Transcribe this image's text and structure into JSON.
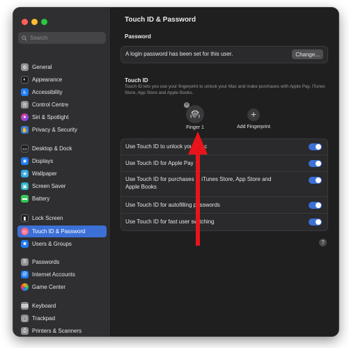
{
  "window": {
    "traffic_colors": [
      "#ff5f57",
      "#febc2e",
      "#28c840"
    ]
  },
  "search": {
    "placeholder": "Search"
  },
  "sidebar": {
    "items": [
      {
        "label": "General",
        "icon": "gear-icon",
        "color": "#8e8e93"
      },
      {
        "label": "Appearance",
        "icon": "appearance-icon",
        "color": "#1c1c1e"
      },
      {
        "label": "Accessibility",
        "icon": "accessibility-icon",
        "color": "#1e7cf2"
      },
      {
        "label": "Control Centre",
        "icon": "control-centre-icon",
        "color": "#8e8e93"
      },
      {
        "label": "Siri & Spotlight",
        "icon": "siri-icon",
        "color": "#c445d8"
      },
      {
        "label": "Privacy & Security",
        "icon": "hand-icon",
        "color": "#3a7bd5"
      },
      {
        "label": "Desktop & Dock",
        "icon": "dock-icon",
        "color": "#1c1c1e"
      },
      {
        "label": "Displays",
        "icon": "display-icon",
        "color": "#1e7cf2"
      },
      {
        "label": "Wallpaper",
        "icon": "wallpaper-icon",
        "color": "#34a8e0"
      },
      {
        "label": "Screen Saver",
        "icon": "screen-saver-icon",
        "color": "#30b0c7"
      },
      {
        "label": "Battery",
        "icon": "battery-icon",
        "color": "#34c759"
      },
      {
        "label": "Lock Screen",
        "icon": "lock-icon",
        "color": "#1c1c1e"
      },
      {
        "label": "Touch ID & Password",
        "icon": "fingerprint-icon",
        "color": "#ff6482",
        "active": true
      },
      {
        "label": "Users & Groups",
        "icon": "users-icon",
        "color": "#1e7cf2"
      },
      {
        "label": "Passwords",
        "icon": "key-icon",
        "color": "#8e8e93"
      },
      {
        "label": "Internet Accounts",
        "icon": "at-icon",
        "color": "#1e7cf2"
      },
      {
        "label": "Game Center",
        "icon": "game-center-icon",
        "color": "#ff9f0a"
      },
      {
        "label": "Keyboard",
        "icon": "keyboard-icon",
        "color": "#8e8e93"
      },
      {
        "label": "Trackpad",
        "icon": "trackpad-icon",
        "color": "#8e8e93"
      },
      {
        "label": "Printers & Scanners",
        "icon": "printer-icon",
        "color": "#8e8e93"
      }
    ]
  },
  "main": {
    "title": "Touch ID & Password",
    "password_section": "Password",
    "password_text": "A login password has been set for this user.",
    "change_label": "Change...",
    "touchid_section": "Touch ID",
    "touchid_desc": "Touch ID lets you use your fingerprint to unlock your Mac and make purchases with Apple Pay, iTunes Store, App Store and Apple Books.",
    "finger_label": "Finger 1",
    "add_label": "Add Fingerprint",
    "options": [
      {
        "label": "Use Touch ID to unlock your Mac",
        "on": true
      },
      {
        "label": "Use Touch ID for Apple Pay",
        "on": true
      },
      {
        "label": "Use Touch ID for purchases in iTunes Store, App Store and Apple Books",
        "on": true
      },
      {
        "label": "Use Touch ID for autofilling passwords",
        "on": true
      },
      {
        "label": "Use Touch ID for fast user switching",
        "on": true
      }
    ],
    "help_label": "?"
  },
  "accent": "#3c70d7",
  "annotation_arrow_color": "#e8141b"
}
